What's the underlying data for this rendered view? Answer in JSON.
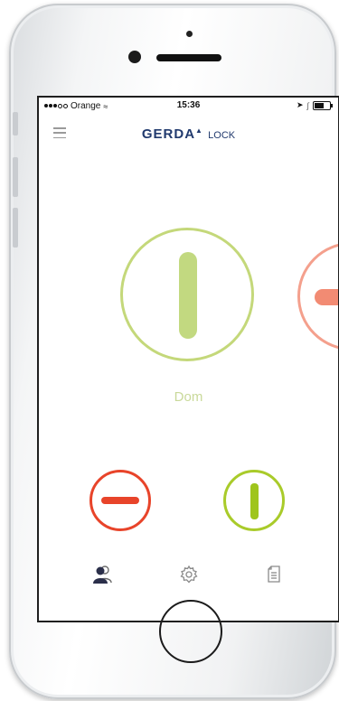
{
  "status_bar": {
    "carrier": "Orange",
    "time": "15:36"
  },
  "header": {
    "logo_brand": "GERDA",
    "logo_suffix": "LOCK",
    "menu_icon": "hamburger-menu-icon"
  },
  "main_lock": {
    "label": "Dom",
    "state": "unlocked",
    "ring_color": "#c4d87a",
    "bar_color": "#b7d26a"
  },
  "next_lock": {
    "state": "locked",
    "ring_color": "#f4a08d",
    "bar_color": "#f28b73"
  },
  "actions": {
    "lock_button_icon": "lock-horizontal-bar-icon",
    "lock_color": "#e8442a",
    "unlock_button_icon": "unlock-vertical-bar-icon",
    "unlock_color": "#a9cb2a"
  },
  "tabs": [
    {
      "icon": "users-icon"
    },
    {
      "icon": "gear-icon"
    },
    {
      "icon": "document-icon"
    }
  ],
  "colors": {
    "brand": "#213a6e"
  }
}
